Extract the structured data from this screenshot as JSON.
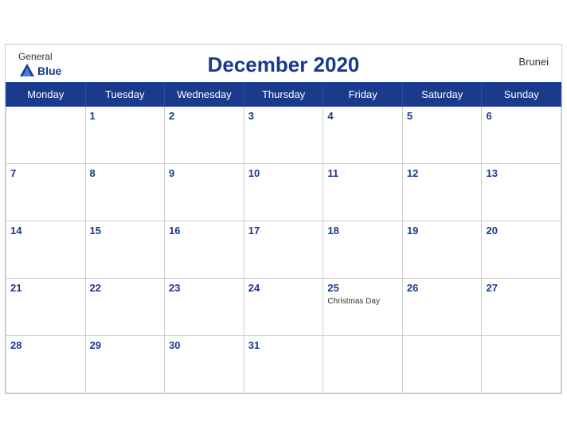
{
  "header": {
    "logo_general": "General",
    "logo_blue": "Blue",
    "title": "December 2020",
    "country": "Brunei"
  },
  "weekdays": [
    "Monday",
    "Tuesday",
    "Wednesday",
    "Thursday",
    "Friday",
    "Saturday",
    "Sunday"
  ],
  "weeks": [
    [
      {
        "day": "",
        "empty": true
      },
      {
        "day": "1"
      },
      {
        "day": "2"
      },
      {
        "day": "3"
      },
      {
        "day": "4"
      },
      {
        "day": "5"
      },
      {
        "day": "6"
      }
    ],
    [
      {
        "day": "7"
      },
      {
        "day": "8"
      },
      {
        "day": "9"
      },
      {
        "day": "10"
      },
      {
        "day": "11"
      },
      {
        "day": "12"
      },
      {
        "day": "13"
      }
    ],
    [
      {
        "day": "14"
      },
      {
        "day": "15"
      },
      {
        "day": "16"
      },
      {
        "day": "17"
      },
      {
        "day": "18"
      },
      {
        "day": "19"
      },
      {
        "day": "20"
      }
    ],
    [
      {
        "day": "21"
      },
      {
        "day": "22"
      },
      {
        "day": "23"
      },
      {
        "day": "24"
      },
      {
        "day": "25",
        "holiday": "Christmas Day"
      },
      {
        "day": "26"
      },
      {
        "day": "27"
      }
    ],
    [
      {
        "day": "28"
      },
      {
        "day": "29"
      },
      {
        "day": "30"
      },
      {
        "day": "31"
      },
      {
        "day": "",
        "empty": true
      },
      {
        "day": "",
        "empty": true
      },
      {
        "day": "",
        "empty": true
      }
    ]
  ]
}
